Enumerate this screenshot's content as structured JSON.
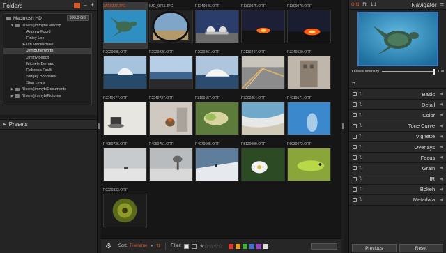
{
  "folders": {
    "title": "Folders",
    "volume": {
      "name": "Macintosh HD",
      "size": "999.3 GB"
    },
    "tree": [
      {
        "label": "/Users/jimmyb/Desktop",
        "level": 1,
        "tri": "▼"
      },
      {
        "label": "Andrew Foord",
        "level": 2
      },
      {
        "label": "Finley Lee",
        "level": 2
      },
      {
        "label": "Ian MacMichael",
        "level": 2,
        "tri": "▶"
      },
      {
        "label": "Jeff Butterworth",
        "level": 2,
        "selected": true
      },
      {
        "label": "Jimmy beech",
        "level": 2
      },
      {
        "label": "Michele Bernard",
        "level": 2
      },
      {
        "label": "Rebecca Faulk",
        "level": 2
      },
      {
        "label": "Sergey Bondarev",
        "level": 2
      },
      {
        "label": "Sian Lewis",
        "level": 2
      },
      {
        "label": "/Users/jimmyb/Documents",
        "level": 1,
        "tri": "▶"
      },
      {
        "label": "/Users/jimmyb/Pictures",
        "level": 1,
        "tri": "▶"
      }
    ]
  },
  "presets": {
    "title": "Presets"
  },
  "thumbnails": [
    {
      "name": "2AC9227.JPG",
      "highlight": true,
      "selected": true,
      "scene": "turtle"
    },
    {
      "name": "IMG_9765.JPG",
      "scene": "fisheye"
    },
    {
      "name": "P1240046.ORF",
      "scene": "observatory"
    },
    {
      "name": "P1300075.ORF",
      "scene": "lava"
    },
    {
      "name": "P1300078.ORF",
      "scene": "lava2"
    },
    {
      "name": "P2020095.ORF",
      "scene": "wave"
    },
    {
      "name": "P2020226.ORF",
      "scene": "seascape"
    },
    {
      "name": "P2020261.ORF",
      "scene": "splash"
    },
    {
      "name": "P2130247.ORF",
      "scene": "road"
    },
    {
      "name": "P2240530.ORF",
      "scene": "building"
    },
    {
      "name": "P2240677.ORF",
      "scene": "teacup"
    },
    {
      "name": "P2240727.ORF",
      "scene": "bird"
    },
    {
      "name": "P3190157.ORF",
      "scene": "lizard"
    },
    {
      "name": "P3290254.ORF",
      "scene": "surf"
    },
    {
      "name": "P4010571.ORF",
      "scene": "blue"
    },
    {
      "name": "P4050736.ORF",
      "scene": "foggy"
    },
    {
      "name": "P4050751.ORF",
      "scene": "fogtree"
    },
    {
      "name": "P4070505.ORF",
      "scene": "skier"
    },
    {
      "name": "P5120099.ORF",
      "scene": "flower"
    },
    {
      "name": "P6030072.ORF",
      "scene": "anole"
    },
    {
      "name": "P9220333.ORF",
      "scene": "sunflower"
    }
  ],
  "bottom_bar": {
    "sort_label": "Sort:",
    "sort_value": "Filename",
    "filter_label": "Filter:",
    "stars": "★☆☆☆☆",
    "swatches": [
      "#e03b2e",
      "#e8a020",
      "#3fae3f",
      "#3a6fd8",
      "#9a45c8",
      "#dddddd"
    ]
  },
  "navigator": {
    "modes": [
      "Grid",
      "Fit",
      "1:1"
    ],
    "title": "Navigator",
    "intensity_label": "Overall intensity",
    "intensity_value": "100",
    "intensity_level": 1.0
  },
  "adjustments": [
    "Basic",
    "Detail",
    "Color",
    "Tone Curve",
    "Vignette",
    "Overlays",
    "Focus",
    "Grain",
    "IR",
    "Bokeh",
    "Metadata"
  ],
  "buttons": {
    "previous": "Previous",
    "reset": "Reset"
  },
  "colors": {
    "accent": "#e05a2b",
    "nav_border": "#3a78c8"
  }
}
